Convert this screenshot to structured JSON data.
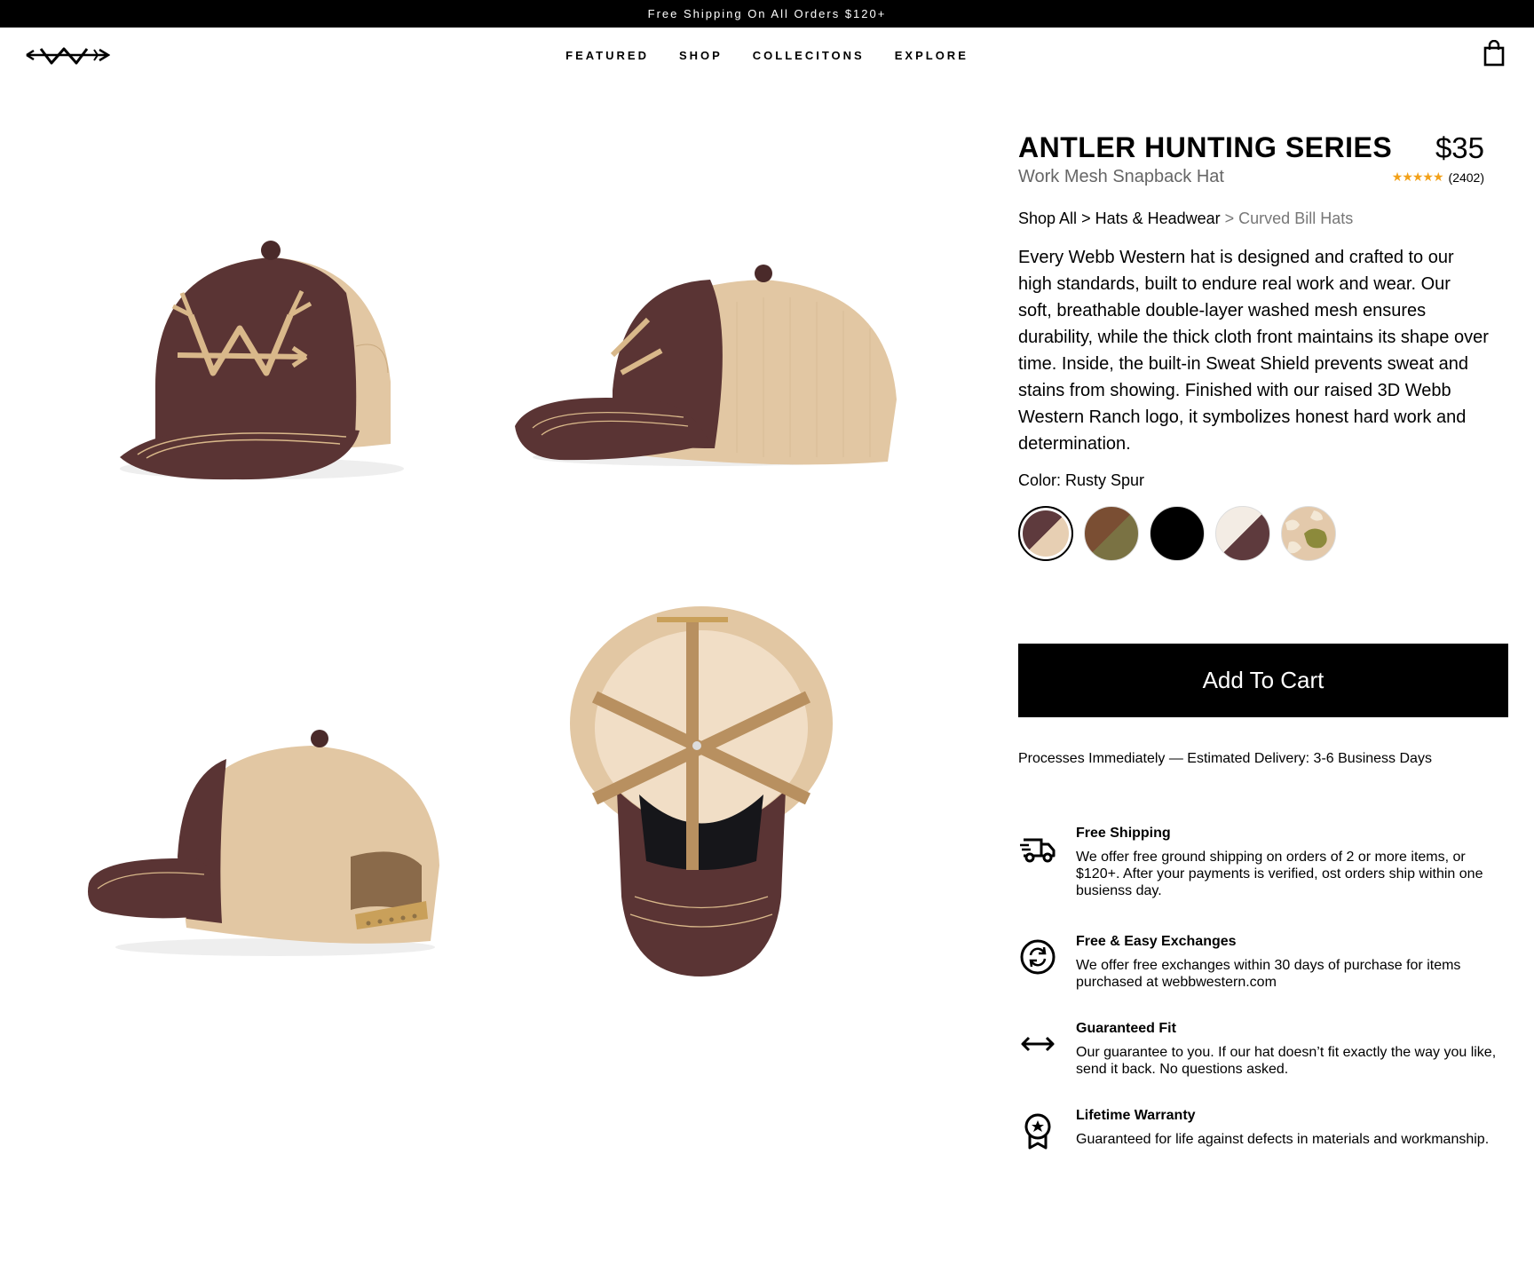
{
  "announcement": "Free Shipping On All Orders $120+",
  "nav": {
    "items": [
      "FEATURED",
      "SHOP",
      "COLLECITONS",
      "EXPLORE"
    ],
    "logo_icon": "arrow-antler-logo",
    "cart_icon": "shopping-bag-icon"
  },
  "product": {
    "title": "ANTLER HUNTING SERIES",
    "price": "$35",
    "subtitle": "Work Mesh Snapback Hat",
    "stars": "★★★★★",
    "rating_value": 5,
    "review_count": "(2402)",
    "breadcrumb": {
      "part1": "Shop All",
      "sep1": " > ",
      "part2": "Hats & Headwear",
      "sep2": " > ",
      "current": "Curved Bill Hats"
    },
    "description": "Every Webb Western hat is designed and crafted to our high standards, built to endure real work and wear. Our soft, breathable double-layer washed mesh ensures durability, while the thick cloth front maintains its shape over time. Inside, the built-in Sweat Shield prevents sweat and stains from showing. Finished with our raised 3D Webb Western Ranch logo, it symbolizes honest hard work and determination.",
    "color_label": "Color: Rusty Spur",
    "swatch_colors": [
      "#5e3a3d",
      "#7a4e33",
      "#000000",
      "#f3ece4",
      "#e3c9ab"
    ],
    "add_to_cart": "Add To Cart",
    "delivery": "Processes Immediately — Estimated Delivery: 3-6 Business Days"
  },
  "features": [
    {
      "icon": "delivery-truck-icon",
      "title": "Free Shipping",
      "desc": "We offer free ground shipping on orders of 2 or more items, or $120+. After your payments is verified, ost orders ship within one busienss day."
    },
    {
      "icon": "exchange-cycle-icon",
      "title": "Free & Easy Exchanges",
      "desc": "We offer free exchanges within 30 days of purchase for items purchased at webbwestern.com"
    },
    {
      "icon": "double-arrow-icon",
      "title": "Guaranteed Fit",
      "desc": "Our guarantee to you. If our hat doesn’t fit exactly the way you like, send it back. No questions asked."
    },
    {
      "icon": "award-ribbon-icon",
      "title": "Lifetime Warranty",
      "desc": "Guaranteed for life against defects in materials and workmanship."
    }
  ],
  "colors": {
    "hat_brown": "#5a3434",
    "mesh_tan": "#e2c7a3",
    "embroidery": "#d9b88a",
    "star": "#f2a11a"
  }
}
